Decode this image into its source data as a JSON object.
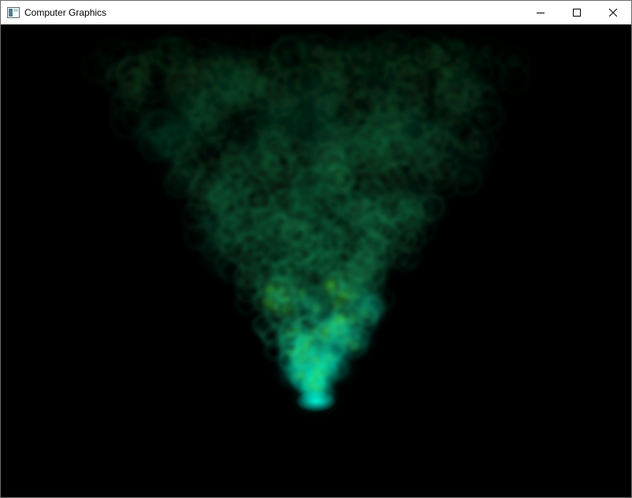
{
  "window": {
    "title": "Computer Graphics",
    "app_icon": "window-app-icon",
    "controls": {
      "minimize_icon": "minimize-icon",
      "maximize_icon": "maximize-icon",
      "close_icon": "close-icon"
    }
  },
  "scene": {
    "background_color": "#000000",
    "particle_colors": {
      "core": "#00ffd5",
      "mid": "#2bdc8a",
      "outer": "#1f7a3a",
      "green_tint": "#5cff3a"
    }
  }
}
